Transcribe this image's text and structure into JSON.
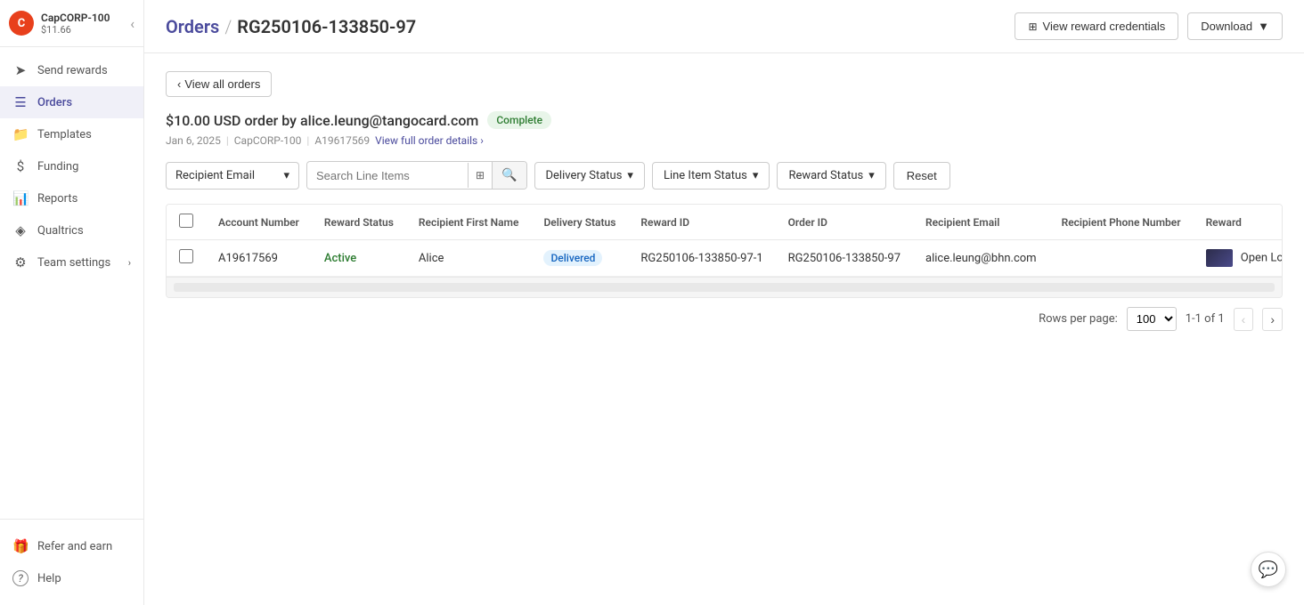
{
  "brand": {
    "name": "CapCORP-100",
    "price": "$11.66",
    "logo_initial": "C"
  },
  "sidebar": {
    "collapse_label": "‹",
    "items": [
      {
        "id": "send-rewards",
        "label": "Send rewards",
        "icon": "➤",
        "active": false
      },
      {
        "id": "orders",
        "label": "Orders",
        "icon": "📋",
        "active": true
      },
      {
        "id": "templates",
        "label": "Templates",
        "icon": "📁",
        "active": false
      },
      {
        "id": "funding",
        "label": "Funding",
        "icon": "$",
        "active": false
      },
      {
        "id": "reports",
        "label": "Reports",
        "icon": "📊",
        "active": false
      },
      {
        "id": "qualtrics",
        "label": "Qualtrics",
        "icon": "◈",
        "active": false
      },
      {
        "id": "team-settings",
        "label": "Team settings",
        "icon": "⚙",
        "active": false,
        "has_chevron": true
      }
    ],
    "bottom_items": [
      {
        "id": "refer-earn",
        "label": "Refer and earn",
        "icon": "🎁"
      },
      {
        "id": "help",
        "label": "Help",
        "icon": "?"
      }
    ]
  },
  "header": {
    "breadcrumb_link": "Orders",
    "breadcrumb_separator": "/",
    "breadcrumb_current": "RG250106-133850-97",
    "view_credentials_label": "View reward credentials",
    "download_label": "Download",
    "download_icon": "▼"
  },
  "back_button": {
    "label": "View all orders",
    "icon": "‹"
  },
  "order": {
    "amount": "$10.00",
    "currency": "USD",
    "by_text": "order by",
    "email": "alice.leung@tangocard.com",
    "status": "Complete",
    "date": "Jan 6, 2025",
    "account": "CapCORP-100",
    "order_id": "A19617569",
    "view_details_label": "View full order details",
    "view_details_icon": "›"
  },
  "filters": {
    "recipient_email_label": "Recipient Email",
    "search_placeholder": "Search Line Items",
    "delivery_status_label": "Delivery Status",
    "line_item_status_label": "Line Item Status",
    "reward_status_label": "Reward Status",
    "reset_label": "Reset",
    "filter_icon": "▾"
  },
  "table": {
    "columns": [
      {
        "id": "account_number",
        "label": "Account Number"
      },
      {
        "id": "reward_status",
        "label": "Reward Status"
      },
      {
        "id": "recipient_first_name",
        "label": "Recipient First Name"
      },
      {
        "id": "delivery_status",
        "label": "Delivery Status"
      },
      {
        "id": "reward_id",
        "label": "Reward ID"
      },
      {
        "id": "order_id",
        "label": "Order ID"
      },
      {
        "id": "recipient_email",
        "label": "Recipient Email"
      },
      {
        "id": "recipient_phone",
        "label": "Recipient Phone Number"
      },
      {
        "id": "reward",
        "label": "Reward"
      }
    ],
    "rows": [
      {
        "account_number": "A19617569",
        "reward_status": "Active",
        "recipient_first_name": "Alice",
        "delivery_status": "Delivered",
        "reward_id": "RG250106-133850-97-1",
        "order_id": "RG250106-133850-97",
        "recipient_email": "alice.leung@bhn.com",
        "recipient_phone": "",
        "reward_name": "Open Loop —"
      }
    ]
  },
  "pagination": {
    "rows_per_page_label": "Rows per page:",
    "rows_per_page_value": "100",
    "page_info": "1-1 of 1"
  }
}
